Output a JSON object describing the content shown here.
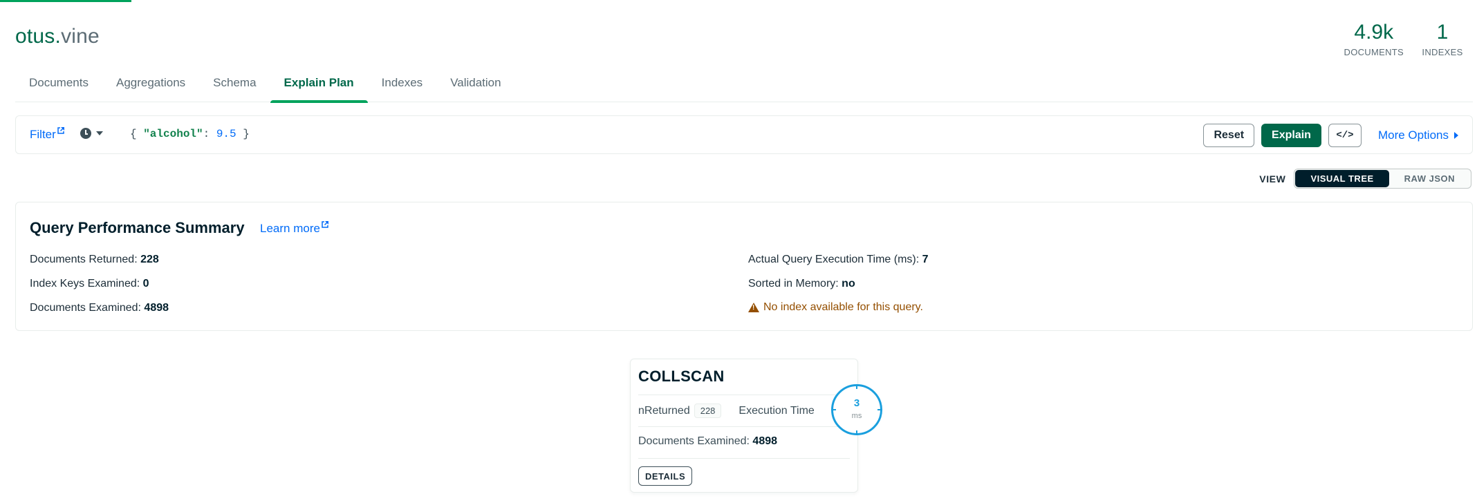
{
  "namespace": {
    "db": "otus",
    "separator": ".",
    "collection": "vine"
  },
  "stats": [
    {
      "value": "4.9k",
      "label": "DOCUMENTS"
    },
    {
      "value": "1",
      "label": "INDEXES"
    }
  ],
  "tabs": [
    {
      "label": "Documents"
    },
    {
      "label": "Aggregations"
    },
    {
      "label": "Schema"
    },
    {
      "label": "Explain Plan",
      "active": true
    },
    {
      "label": "Indexes"
    },
    {
      "label": "Validation"
    }
  ],
  "querybar": {
    "filter_label": "Filter",
    "filter_value": {
      "open": "{ ",
      "key": "\"alcohol\"",
      "colon": ": ",
      "number": "9.5",
      "close": " }"
    },
    "reset_label": "Reset",
    "explain_label": "Explain",
    "code_label": "</>",
    "more_options_label": "More Options"
  },
  "view": {
    "label": "VIEW",
    "options": [
      "VISUAL TREE",
      "RAW JSON"
    ],
    "selected": "VISUAL TREE"
  },
  "summary": {
    "title": "Query Performance Summary",
    "learn_more": "Learn more",
    "docs_returned_label": "Documents Returned:",
    "docs_returned": "228",
    "index_keys_label": "Index Keys Examined:",
    "index_keys": "0",
    "docs_examined_label": "Documents Examined:",
    "docs_examined": "4898",
    "exec_time_label": "Actual Query Execution Time (ms):",
    "exec_time": "7",
    "sorted_label": "Sorted in Memory:",
    "sorted": "no",
    "warning": "No index available for this query."
  },
  "stage": {
    "name": "COLLSCAN",
    "nreturned_label": "nReturned",
    "nreturned": "228",
    "exec_time_label": "Execution Time",
    "exec_time": "3",
    "exec_unit": "ms",
    "docs_examined_label": "Documents Examined:",
    "docs_examined": "4898",
    "details_label": "DETAILS"
  },
  "colors": {
    "brand_green": "#00684a",
    "link_blue": "#016bf8",
    "warning": "#944f01",
    "timer_blue": "#1a9fde"
  }
}
